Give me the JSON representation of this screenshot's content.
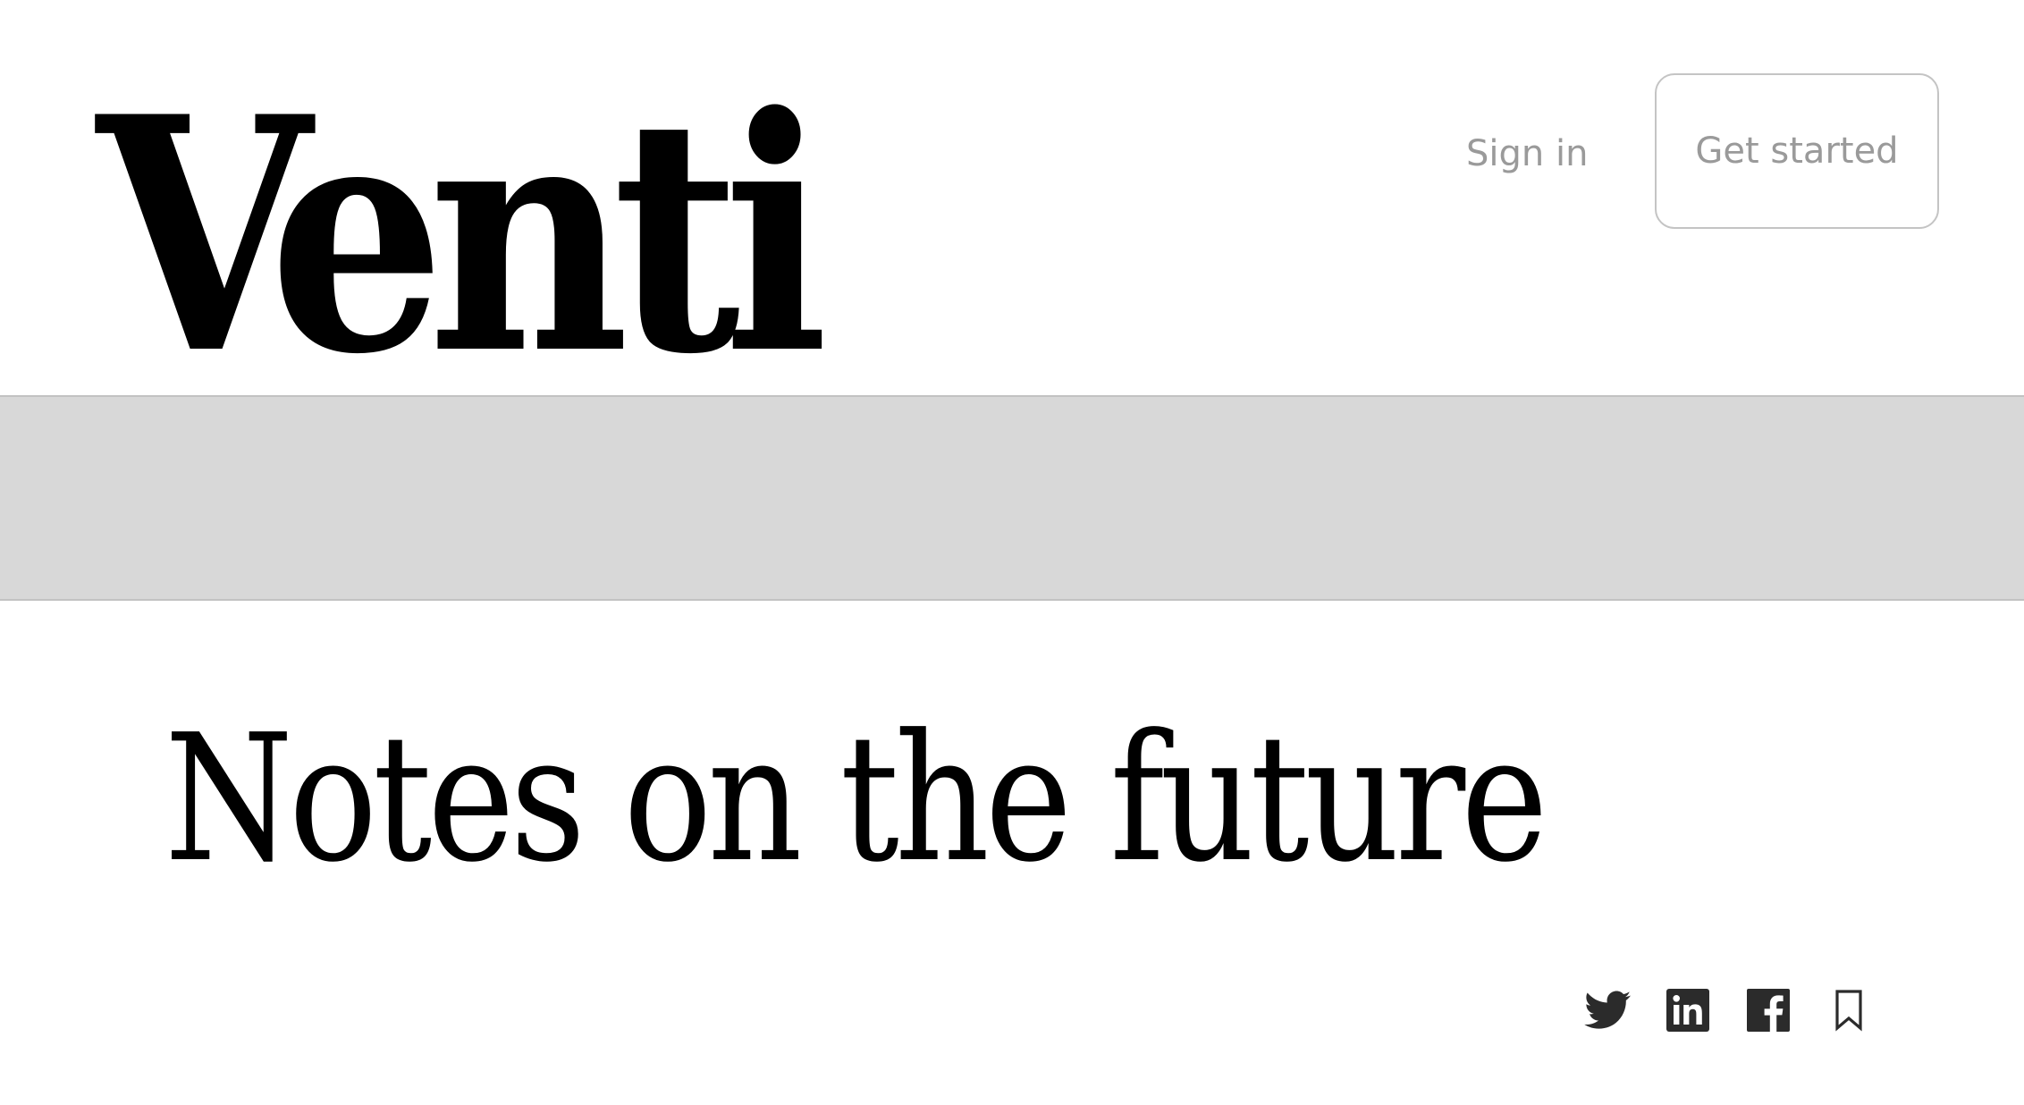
{
  "header": {
    "logo_text": "Venti",
    "signin_label": "Sign in",
    "get_started_label": "Get started"
  },
  "article": {
    "title": "Notes on the future"
  },
  "share": {
    "icons": [
      "twitter-icon",
      "linkedin-icon",
      "facebook-icon",
      "bookmark-icon"
    ]
  },
  "colors": {
    "text": "#000000",
    "muted": "#9a9a9a",
    "banner": "#d8d8d8",
    "border": "#c4c4c4",
    "icon": "#2b2b2b"
  }
}
